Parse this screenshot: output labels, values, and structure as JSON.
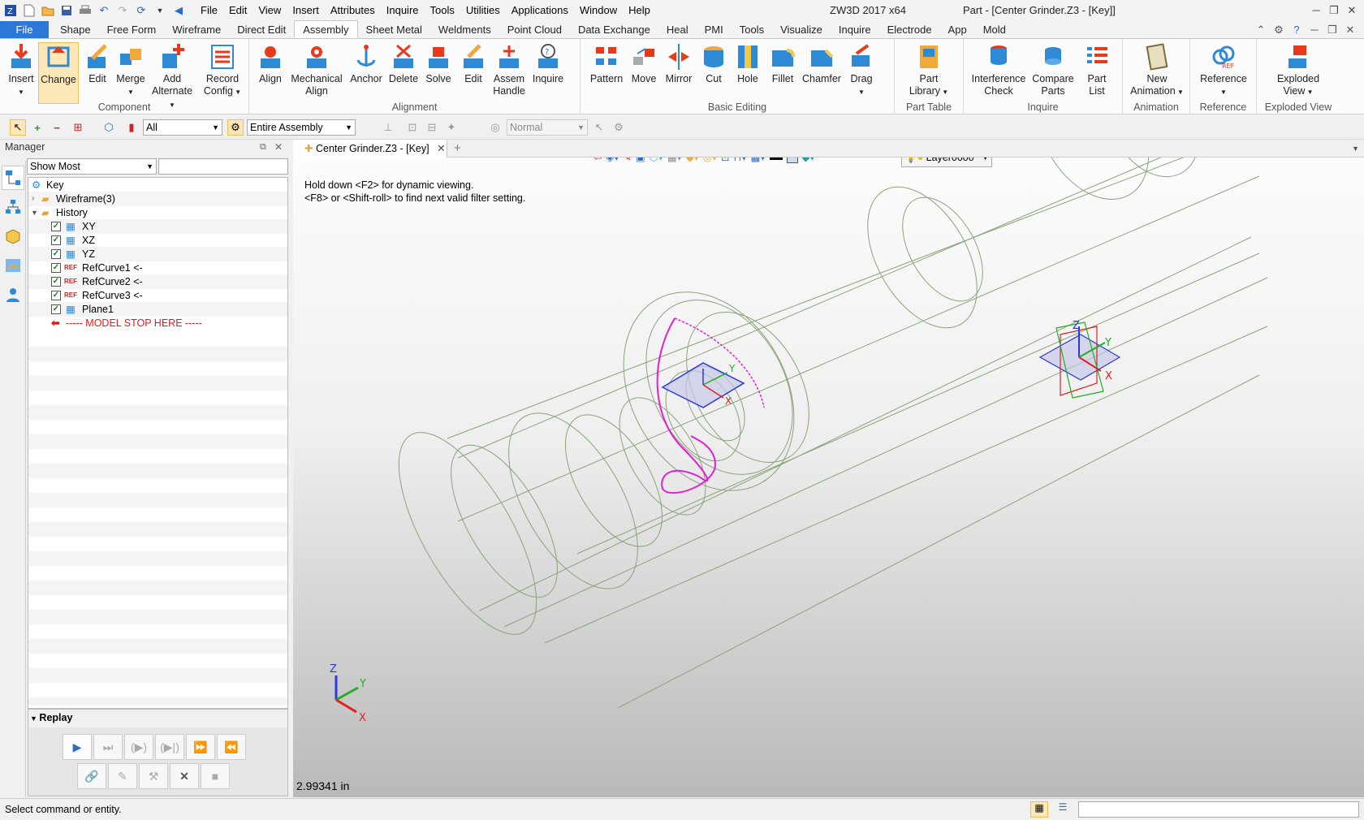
{
  "app": {
    "name": "ZW3D 2017  x64",
    "doc_title": "Part - [Center Grinder.Z3 - [Key]]"
  },
  "menu": [
    "File",
    "Edit",
    "View",
    "Insert",
    "Attributes",
    "Inquire",
    "Tools",
    "Utilities",
    "Applications",
    "Window",
    "Help"
  ],
  "tabs": [
    "File",
    "Shape",
    "Free Form",
    "Wireframe",
    "Direct Edit",
    "Assembly",
    "Sheet Metal",
    "Weldments",
    "Point Cloud",
    "Data Exchange",
    "Heal",
    "PMI",
    "Tools",
    "Visualize",
    "Inquire",
    "Electrode",
    "App",
    "Mold"
  ],
  "active_tab": "Assembly",
  "ribbon": {
    "component": {
      "label": "Component",
      "insert": "Insert",
      "change": "Change",
      "edit": "Edit",
      "merge": "Merge",
      "add_alt_1": "Add",
      "add_alt_2": "Alternate",
      "record_1": "Record",
      "record_2": "Config"
    },
    "alignment": {
      "label": "Alignment",
      "align": "Align",
      "mech_1": "Mechanical",
      "mech_2": "Align",
      "anchor": "Anchor",
      "delete": "Delete",
      "solve": "Solve",
      "edit": "Edit",
      "assem_1": "Assem",
      "assem_2": "Handle",
      "inquire": "Inquire"
    },
    "basic": {
      "label": "Basic Editing",
      "pattern": "Pattern",
      "move": "Move",
      "mirror": "Mirror",
      "cut": "Cut",
      "hole": "Hole",
      "fillet": "Fillet",
      "chamfer": "Chamfer",
      "drag": "Drag"
    },
    "parttable": {
      "label": "Part Table",
      "lib_1": "Part",
      "lib_2": "Library"
    },
    "inquire": {
      "label": "Inquire",
      "inter_1": "Interference",
      "inter_2": "Check",
      "cmp_1": "Compare",
      "cmp_2": "Parts",
      "pl_1": "Part",
      "pl_2": "List"
    },
    "animation": {
      "label": "Animation",
      "new_1": "New",
      "new_2": "Animation"
    },
    "reference": {
      "label": "Reference",
      "ref": "Reference"
    },
    "exploded": {
      "label": "Exploded View",
      "ev_1": "Exploded",
      "ev_2": "View"
    }
  },
  "toolbar": {
    "filter": "All",
    "scope": "Entire Assembly",
    "mode": "Normal"
  },
  "manager": {
    "title": "Manager",
    "show": "Show Most",
    "tree": [
      {
        "label": "Key"
      },
      {
        "label": "Wireframe(3)"
      },
      {
        "label": "History"
      },
      {
        "label": "XY"
      },
      {
        "label": "XZ"
      },
      {
        "label": "YZ"
      },
      {
        "label": "RefCurve1 <-"
      },
      {
        "label": "RefCurve2 <-"
      },
      {
        "label": "RefCurve3 <-"
      },
      {
        "label": "Plane1"
      },
      {
        "label": "----- MODEL STOP HERE -----"
      }
    ],
    "replay": "Replay"
  },
  "viewport": {
    "tab": "Center Grinder.Z3 - [Key]",
    "hint1": "Hold down <F2> for dynamic viewing.",
    "hint2": "<F8> or <Shift-roll> to find next valid filter setting.",
    "layer": "Layer0000",
    "scale": "2.99341 in",
    "axis_x": "X",
    "axis_y": "Y",
    "axis_z": "Z"
  },
  "status": {
    "text": "Select command or entity."
  }
}
